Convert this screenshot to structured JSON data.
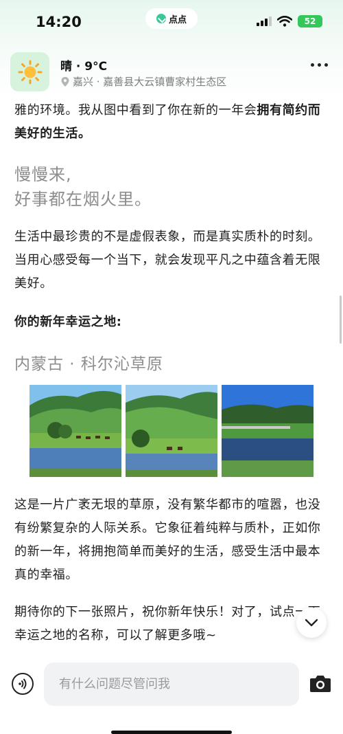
{
  "status": {
    "time": "14:20",
    "app_pill": "点点",
    "battery": "52"
  },
  "header": {
    "weather": "晴 · 9°C",
    "location": "嘉兴 · 嘉善县大云镇曹家村生态区"
  },
  "content": {
    "para1_a": "雅的环境。我从图中看到了你在新的一年会",
    "para1_bold": "拥有简约而美好的生活。",
    "quote_line1": "慢慢来,",
    "quote_line2": "好事都在烟火里。",
    "para2": "生活中最珍贵的不是虚假表象，而是真实质朴的时刻。当用心感受每一个当下，就会发现平凡之中蕴含着无限美好。",
    "section_title": "你的新年幸运之地:",
    "place_name": "内蒙古 · 科尔沁草原",
    "para3": "这是一片广袤无垠的草原，没有繁华都市的喧嚣，也没有纷繁复杂的人际关系。它象征着纯粹与质朴，正如你的新一年，将拥抱简单而美好的生活，感受生活中最本真的幸福。",
    "para4": "期待你的下一张照片，祝你新年快乐！对了，试点一下幸运之地的名称，可以了解更多哦~"
  },
  "input": {
    "placeholder": "有什么问题尽管问我"
  },
  "icons": {
    "weather": "sun-icon",
    "location": "location-pin-icon",
    "more": "more-dots-icon",
    "scroll": "chevron-down-icon",
    "voice": "voice-icon",
    "camera": "camera-icon"
  },
  "colors": {
    "accent": "#3cc79a",
    "battery": "#34c759",
    "weather_tile": "#d7f3de"
  }
}
